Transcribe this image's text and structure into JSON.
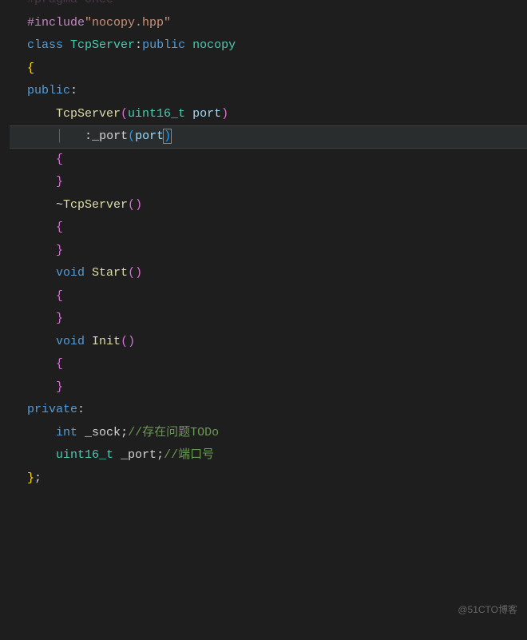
{
  "watermark": "@51CTO博客",
  "lines": [
    {
      "indent": 0,
      "highlight": false,
      "tokens": [
        {
          "cls": "directive",
          "t": "#pragma once"
        }
      ]
    },
    {
      "indent": 0,
      "highlight": false,
      "tokens": [
        {
          "cls": "directive",
          "t": "#include"
        },
        {
          "cls": "string",
          "t": "\"nocopy.hpp\""
        }
      ]
    },
    {
      "indent": 0,
      "highlight": false,
      "tokens": [
        {
          "cls": "keyword",
          "t": "class"
        },
        {
          "cls": "plain",
          "t": " "
        },
        {
          "cls": "classname",
          "t": "TcpServer"
        },
        {
          "cls": "punct",
          "t": ":"
        },
        {
          "cls": "keyword",
          "t": "public"
        },
        {
          "cls": "plain",
          "t": " "
        },
        {
          "cls": "classname",
          "t": "nocopy"
        }
      ]
    },
    {
      "indent": 0,
      "highlight": false,
      "tokens": [
        {
          "cls": "brace-y",
          "t": "{"
        }
      ]
    },
    {
      "indent": 0,
      "highlight": false,
      "tokens": [
        {
          "cls": "keyword",
          "t": "public"
        },
        {
          "cls": "punct",
          "t": ":"
        }
      ]
    },
    {
      "indent": 1,
      "highlight": false,
      "tokens": [
        {
          "cls": "funcname",
          "t": "TcpServer"
        },
        {
          "cls": "brace",
          "t": "("
        },
        {
          "cls": "type",
          "t": "uint16_t"
        },
        {
          "cls": "plain",
          "t": " "
        },
        {
          "cls": "param",
          "t": "port"
        },
        {
          "cls": "brace",
          "t": ")"
        }
      ]
    },
    {
      "indent": 2,
      "highlight": true,
      "tokens": [
        {
          "cls": "punct",
          "t": ":"
        },
        {
          "cls": "member",
          "t": "_port"
        },
        {
          "cls": "brace-b",
          "t": "("
        },
        {
          "cls": "param",
          "t": "port"
        },
        {
          "cls": "brace-b cursor-paren",
          "t": ")"
        }
      ]
    },
    {
      "indent": 1,
      "highlight": false,
      "tokens": [
        {
          "cls": "brace",
          "t": "{"
        }
      ]
    },
    {
      "indent": 0,
      "highlight": false,
      "tokens": []
    },
    {
      "indent": 1,
      "highlight": false,
      "tokens": [
        {
          "cls": "brace",
          "t": "}"
        }
      ]
    },
    {
      "indent": 1,
      "highlight": false,
      "tokens": [
        {
          "cls": "punct",
          "t": "~"
        },
        {
          "cls": "funcname",
          "t": "TcpServer"
        },
        {
          "cls": "brace",
          "t": "("
        },
        {
          "cls": "brace",
          "t": ")"
        }
      ]
    },
    {
      "indent": 1,
      "highlight": false,
      "tokens": [
        {
          "cls": "brace",
          "t": "{"
        }
      ]
    },
    {
      "indent": 0,
      "highlight": false,
      "tokens": []
    },
    {
      "indent": 1,
      "highlight": false,
      "tokens": [
        {
          "cls": "brace",
          "t": "}"
        }
      ]
    },
    {
      "indent": 1,
      "highlight": false,
      "tokens": [
        {
          "cls": "keyword",
          "t": "void"
        },
        {
          "cls": "plain",
          "t": " "
        },
        {
          "cls": "funcname",
          "t": "Start"
        },
        {
          "cls": "brace",
          "t": "("
        },
        {
          "cls": "brace",
          "t": ")"
        }
      ]
    },
    {
      "indent": 1,
      "highlight": false,
      "tokens": [
        {
          "cls": "brace",
          "t": "{"
        }
      ]
    },
    {
      "indent": 0,
      "highlight": false,
      "tokens": []
    },
    {
      "indent": 1,
      "highlight": false,
      "tokens": [
        {
          "cls": "brace",
          "t": "}"
        }
      ]
    },
    {
      "indent": 1,
      "highlight": false,
      "tokens": [
        {
          "cls": "keyword",
          "t": "void"
        },
        {
          "cls": "plain",
          "t": " "
        },
        {
          "cls": "funcname",
          "t": "Init"
        },
        {
          "cls": "brace",
          "t": "("
        },
        {
          "cls": "brace",
          "t": ")"
        }
      ]
    },
    {
      "indent": 1,
      "highlight": false,
      "tokens": [
        {
          "cls": "brace",
          "t": "{"
        }
      ]
    },
    {
      "indent": 0,
      "highlight": false,
      "tokens": []
    },
    {
      "indent": 1,
      "highlight": false,
      "tokens": [
        {
          "cls": "brace",
          "t": "}"
        }
      ]
    },
    {
      "indent": 0,
      "highlight": false,
      "tokens": [
        {
          "cls": "keyword",
          "t": "private"
        },
        {
          "cls": "punct",
          "t": ":"
        }
      ]
    },
    {
      "indent": 1,
      "highlight": false,
      "tokens": [
        {
          "cls": "keyword",
          "t": "int"
        },
        {
          "cls": "plain",
          "t": " "
        },
        {
          "cls": "member",
          "t": "_sock"
        },
        {
          "cls": "punct",
          "t": ";"
        },
        {
          "cls": "comment",
          "t": "//存在问题TODo"
        }
      ]
    },
    {
      "indent": 1,
      "highlight": false,
      "tokens": [
        {
          "cls": "type",
          "t": "uint16_t"
        },
        {
          "cls": "plain",
          "t": " "
        },
        {
          "cls": "member",
          "t": "_port"
        },
        {
          "cls": "punct",
          "t": ";"
        },
        {
          "cls": "comment",
          "t": "//端口号"
        }
      ]
    },
    {
      "indent": 0,
      "highlight": false,
      "tokens": [
        {
          "cls": "brace-y",
          "t": "}"
        },
        {
          "cls": "punct",
          "t": ";"
        }
      ]
    }
  ]
}
